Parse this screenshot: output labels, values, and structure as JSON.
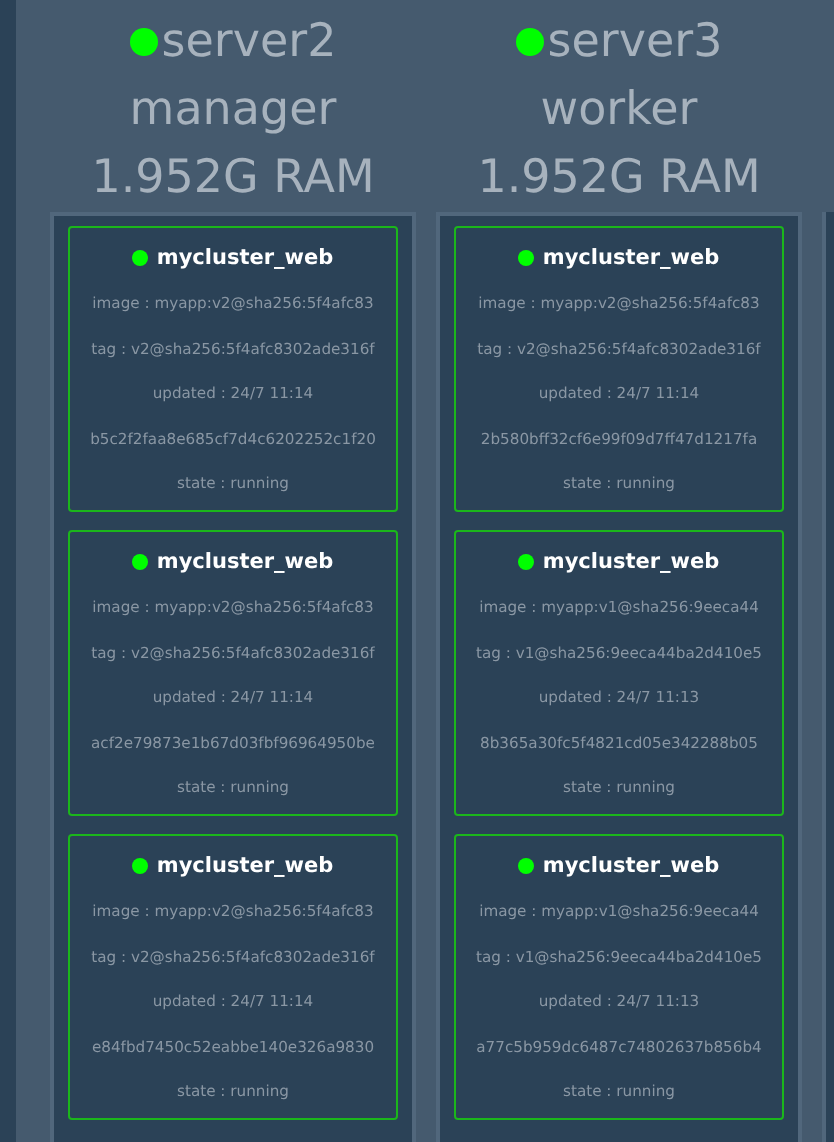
{
  "nodes": [
    {
      "name": "server2",
      "role": "manager",
      "ram": "1.952G RAM",
      "tasks": [
        {
          "service": "mycluster_web",
          "image": "image : myapp:v2@sha256:5f4afc83",
          "tag": "tag : v2@sha256:5f4afc8302ade316f",
          "updated": "updated : 24/7 11:14",
          "id": "b5c2f2faa8e685cf7d4c6202252c1f20",
          "state": "state : running"
        },
        {
          "service": "mycluster_web",
          "image": "image : myapp:v2@sha256:5f4afc83",
          "tag": "tag : v2@sha256:5f4afc8302ade316f",
          "updated": "updated : 24/7 11:14",
          "id": "acf2e79873e1b67d03fbf96964950be",
          "state": "state : running"
        },
        {
          "service": "mycluster_web",
          "image": "image : myapp:v2@sha256:5f4afc83",
          "tag": "tag : v2@sha256:5f4afc8302ade316f",
          "updated": "updated : 24/7 11:14",
          "id": "e84fbd7450c52eabbe140e326a9830",
          "state": "state : running"
        }
      ]
    },
    {
      "name": "server3",
      "role": "worker",
      "ram": "1.952G RAM",
      "tasks": [
        {
          "service": "mycluster_web",
          "image": "image : myapp:v2@sha256:5f4afc83",
          "tag": "tag : v2@sha256:5f4afc8302ade316f",
          "updated": "updated : 24/7 11:14",
          "id": "2b580bff32cf6e99f09d7ff47d1217fa",
          "state": "state : running"
        },
        {
          "service": "mycluster_web",
          "image": "image : myapp:v1@sha256:9eeca44",
          "tag": "tag : v1@sha256:9eeca44ba2d410e5",
          "updated": "updated : 24/7 11:13",
          "id": "8b365a30fc5f4821cd05e342288b05",
          "state": "state : running"
        },
        {
          "service": "mycluster_web",
          "image": "image : myapp:v1@sha256:9eeca44",
          "tag": "tag : v1@sha256:9eeca44ba2d410e5",
          "updated": "updated : 24/7 11:13",
          "id": "a77c5b959dc6487c74802637b856b4",
          "state": "state : running"
        }
      ]
    }
  ]
}
